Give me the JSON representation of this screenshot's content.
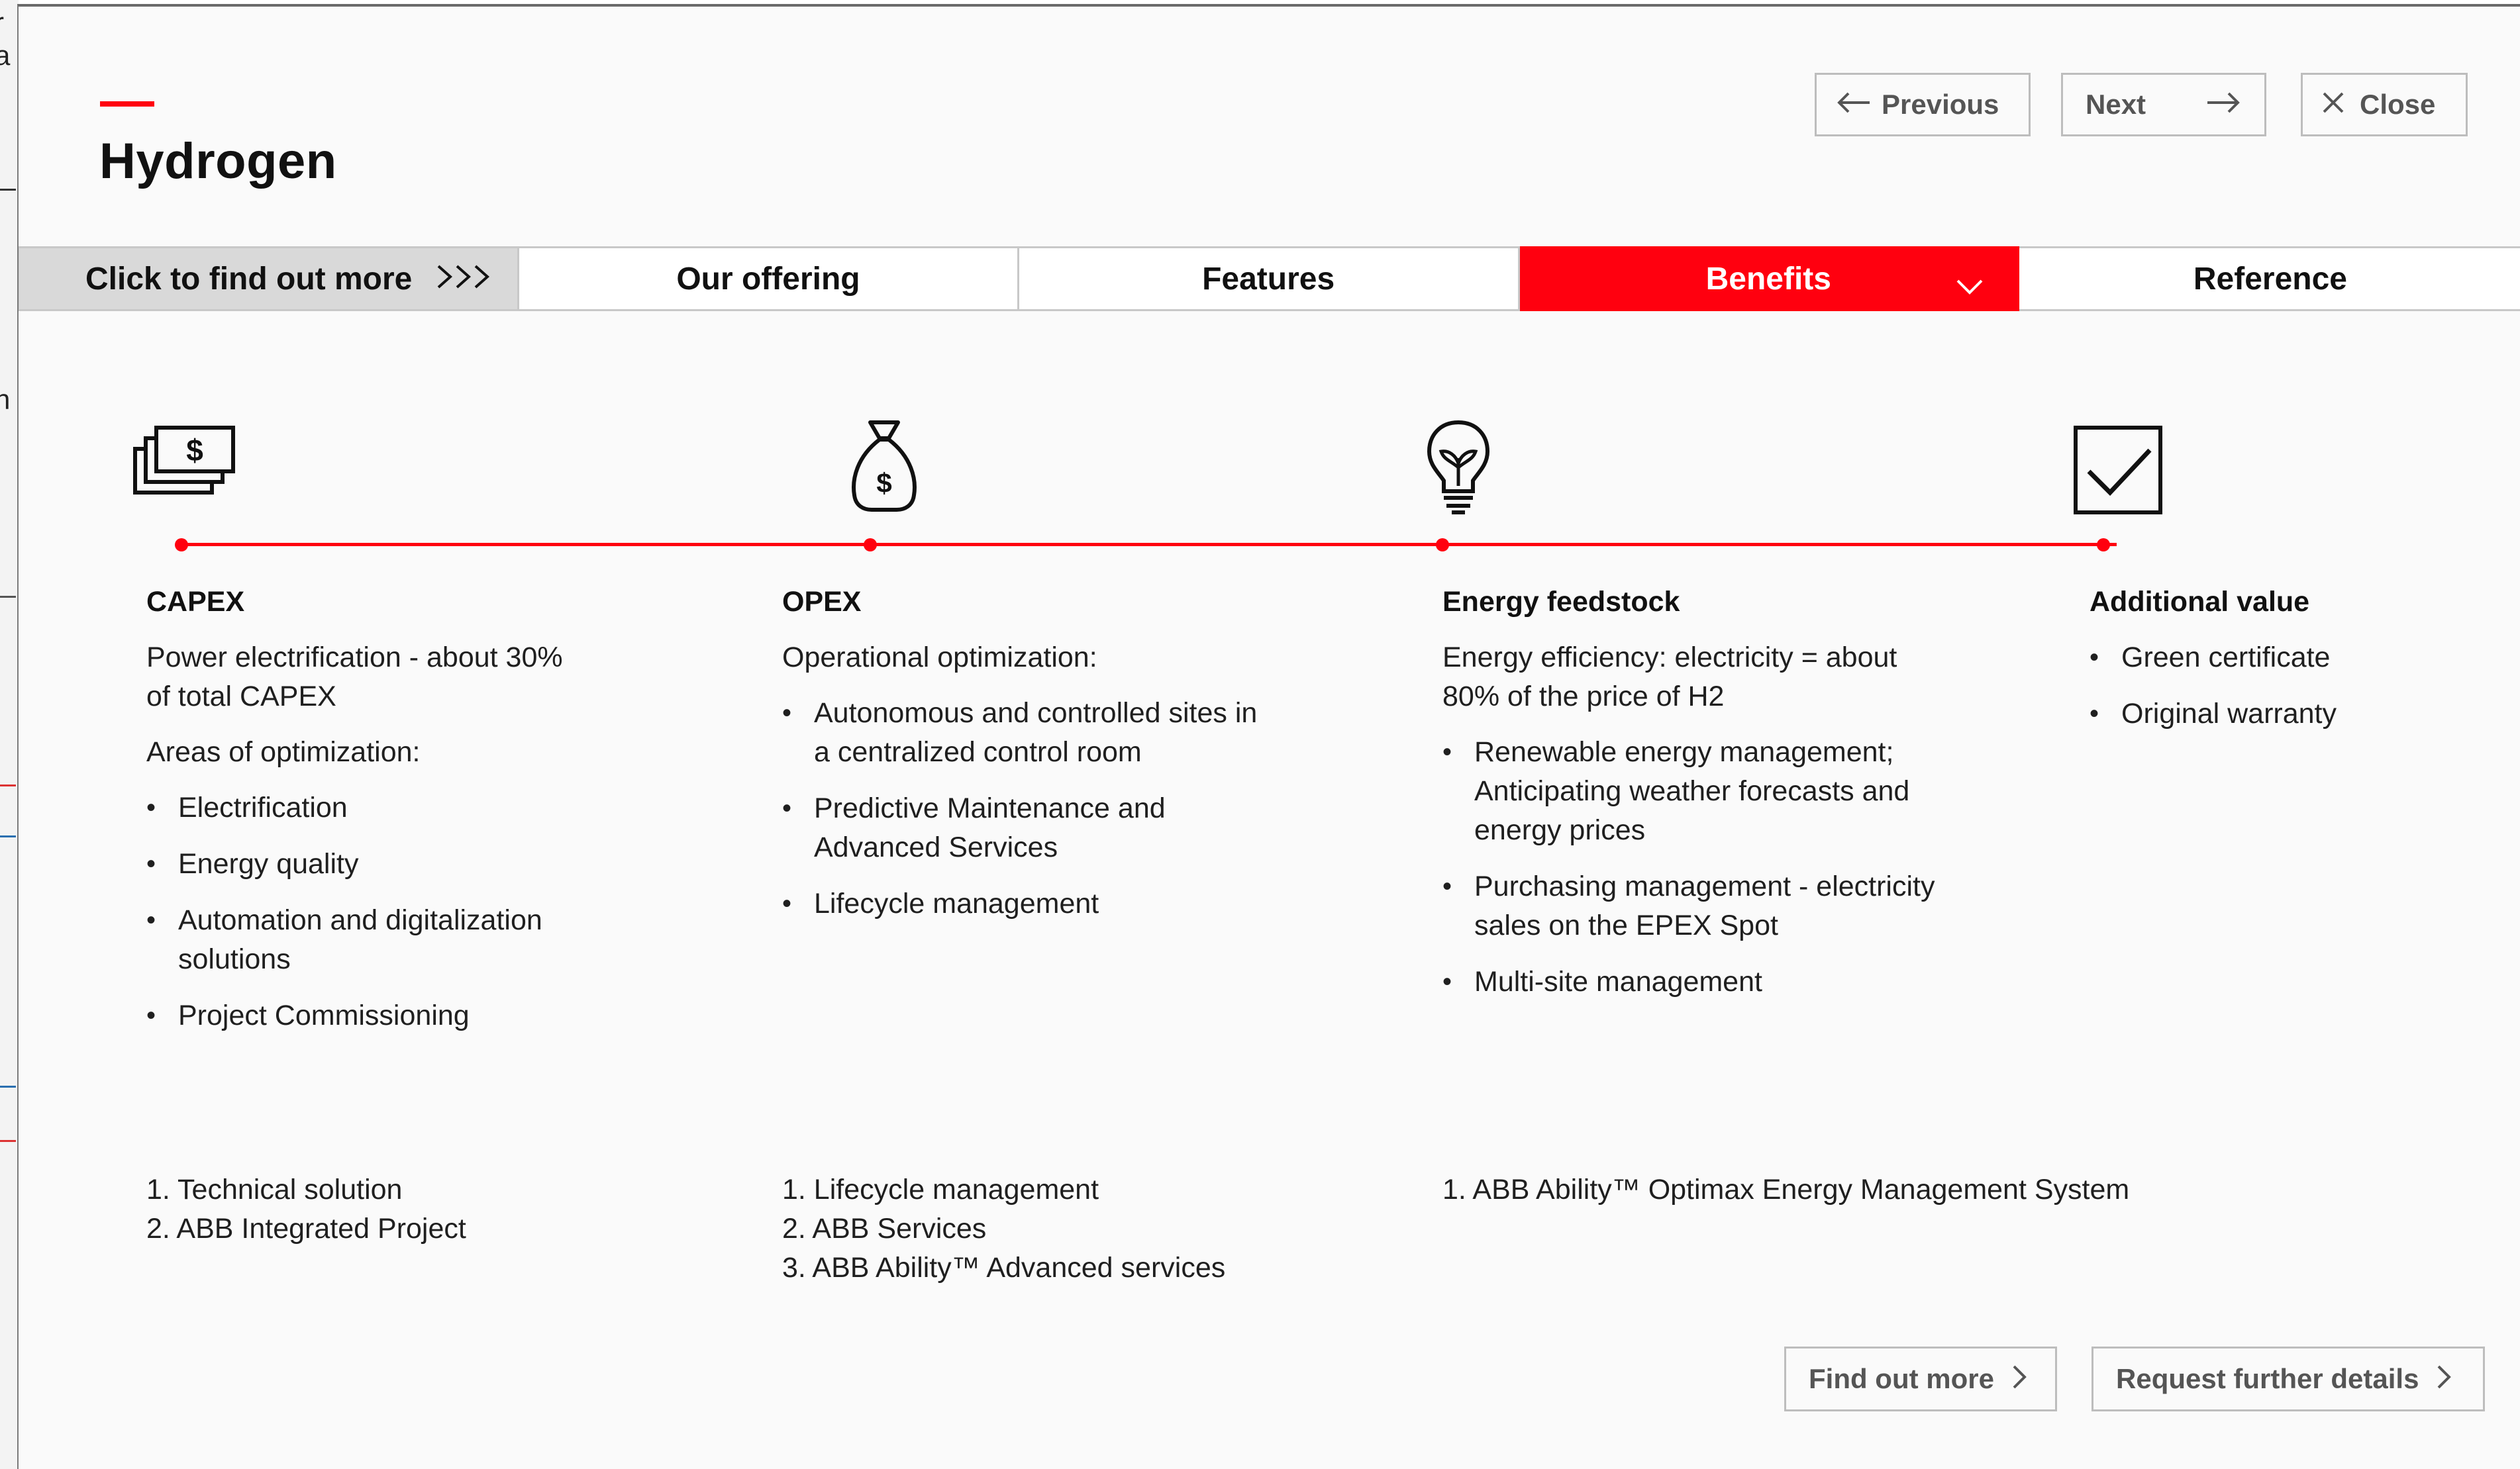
{
  "app": {
    "title": "Hydrogen"
  },
  "header": {
    "previous_label": "Previous",
    "next_label": "Next",
    "close_label": "Close"
  },
  "tabs": [
    {
      "label": "Click to find out more",
      "chev": ">>>"
    },
    {
      "label": "Our offering"
    },
    {
      "label": "Features"
    },
    {
      "label": "Benefits",
      "active": true
    },
    {
      "label": "Reference"
    }
  ],
  "timeline": {
    "icons": [
      "money-stack-icon",
      "money-bag-icon",
      "lightbulb-leaf-icon",
      "checkbox-check-icon"
    ],
    "accent_color": "#ff000f"
  },
  "columns": [
    {
      "heading": "CAPEX",
      "paragraphs": [
        "Power electrification - about 30% of total CAPEX",
        "Areas of optimization:"
      ],
      "bullets": [
        "Electrification",
        "Energy quality",
        "Automation and digitalization solutions",
        "Project Commissioning"
      ]
    },
    {
      "heading": "OPEX",
      "paragraphs": [
        "Operational optimization:"
      ],
      "bullets": [
        "Autonomous and controlled sites in a centralized control room",
        "Predictive Maintenance and Advanced Services",
        "Lifecycle management"
      ]
    },
    {
      "heading": "Energy feedstock",
      "paragraphs": [
        "Energy efficiency: electricity = about 80% of the price of H2"
      ],
      "bullets": [
        "Renewable energy management; Anticipating weather forecasts and energy prices",
        "Purchasing management - electricity sales on the EPEX Spot",
        "Multi-site management"
      ]
    },
    {
      "heading": "Additional value",
      "paragraphs": [],
      "bullets": [
        "Green certificate",
        "Original warranty"
      ]
    }
  ],
  "references": [
    [
      "1. Technical solution",
      "2. ABB Integrated Project"
    ],
    [
      "1. Lifecycle management",
      "2. ABB Services",
      "3. ABB Ability™ Advanced services"
    ],
    [
      "1. ABB Ability™ Optimax Energy Management System"
    ]
  ],
  "footer": {
    "find_out_more_label": "Find out more",
    "request_details_label": "Request further details"
  },
  "colors": {
    "brand_red": "#ff000f",
    "tab_inactive_bg": "#d9d9d9",
    "button_border": "#bdbdbd"
  }
}
